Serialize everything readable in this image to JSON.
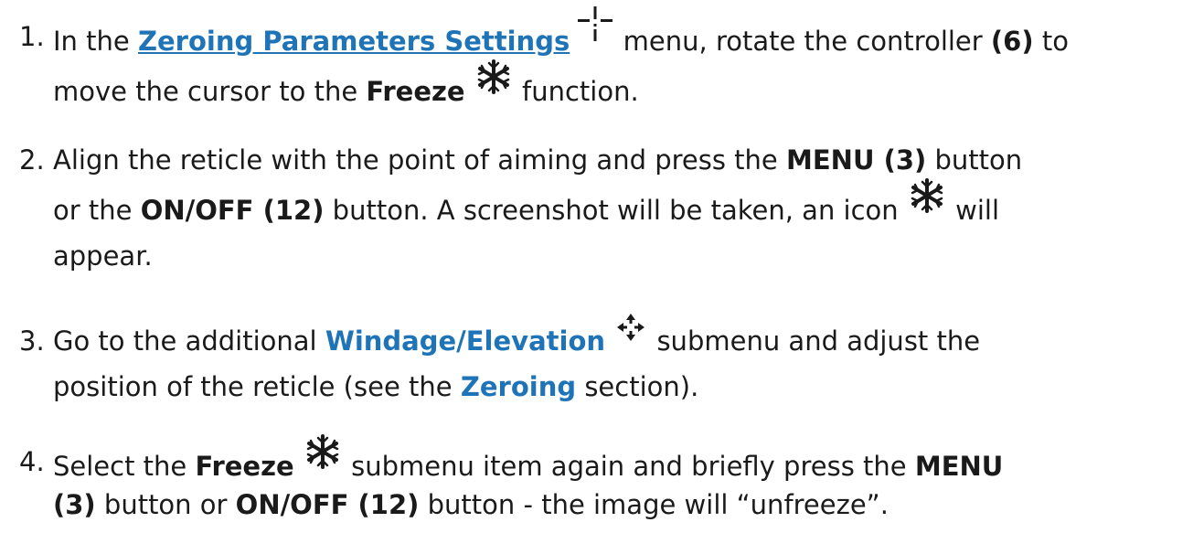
{
  "steps": [
    {
      "number": "1.",
      "t1": "In the",
      "link": "Zeroing Parameters Settings",
      "t2": "menu, rotate the controller",
      "b1": "(6)",
      "t3": "to",
      "t4": "move the cursor to the",
      "b2": "Freeze",
      "t5": "function."
    },
    {
      "number": "2.",
      "t1": "Align the reticle with the point of aiming and press the",
      "b1": "MENU (3)",
      "t2": "button",
      "t3": "or the",
      "b2": "ON/OFF (12)",
      "t4": "button. A screenshot will be taken, an icon",
      "t5": "will",
      "t6": "appear."
    },
    {
      "number": "3.",
      "t1": "Go to the additional",
      "link": "Windage/Elevation",
      "t2": "submenu and adjust the",
      "t3": "position of the reticle (see the",
      "link2": "Zeroing",
      "t4": "section)."
    },
    {
      "number": "4.",
      "t1": "Select the",
      "b1": "Freeze",
      "t2": "submenu item again and briefly press the",
      "b2": "MENU",
      "b3": "(3)",
      "t3": "button or",
      "b4": "ON/OFF (12)",
      "t4": "button - the image will “unfreeze”."
    }
  ],
  "colors": {
    "link": "#1f74b8",
    "text": "#1a1a1a"
  },
  "icons": [
    "zeroing-crosshair-icon",
    "snowflake-icon",
    "move-arrows-icon"
  ]
}
